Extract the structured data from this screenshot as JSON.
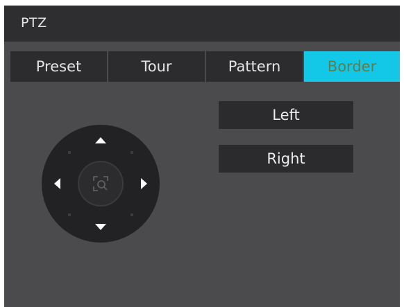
{
  "window": {
    "title": "PTZ"
  },
  "tabs": [
    {
      "label": "Preset",
      "active": false
    },
    {
      "label": "Tour",
      "active": false
    },
    {
      "label": "Pattern",
      "active": false
    },
    {
      "label": "Border",
      "active": true
    }
  ],
  "border": {
    "left_label": "Left",
    "right_label": "Right"
  },
  "dpad": {
    "icons": [
      "arrow-up-icon",
      "arrow-down-icon",
      "arrow-left-icon",
      "arrow-right-icon",
      "zoom-area-icon"
    ]
  },
  "colors": {
    "panel_bg": "#4b4b4d",
    "titlebar_bg": "#2e2e30",
    "tab_bg": "#2c2c2e",
    "tab_active_bg": "#13c8e6",
    "tab_active_text": "#5b7d52",
    "button_bg": "#2b2b2d",
    "dpad_bg": "#222224"
  }
}
